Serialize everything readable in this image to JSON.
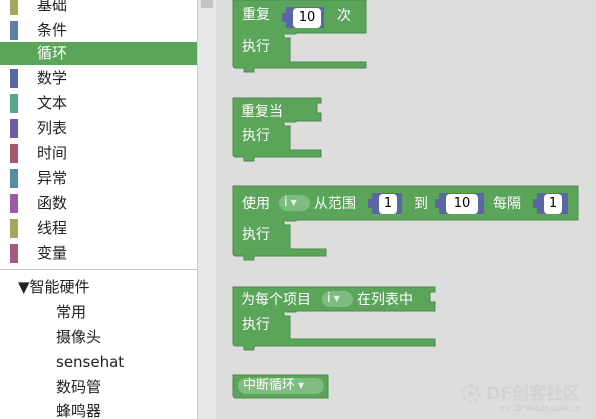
{
  "toolbox": {
    "categories": [
      {
        "label": "基础",
        "color": "#a5a55b"
      },
      {
        "label": "条件",
        "color": "#5b80a5"
      },
      {
        "label": "循环",
        "color": "#5ba55b",
        "selected": true
      },
      {
        "label": "数学",
        "color": "#5b67a5"
      },
      {
        "label": "文本",
        "color": "#5ba58c"
      },
      {
        "label": "列表",
        "color": "#745ba5"
      },
      {
        "label": "时间",
        "color": "#a55b67"
      },
      {
        "label": "异常",
        "color": "#5b8ca5"
      },
      {
        "label": "函数",
        "color": "#995ba5"
      },
      {
        "label": "线程",
        "color": "#a5a55b"
      },
      {
        "label": "变量",
        "color": "#a55b80"
      }
    ],
    "group": {
      "arrow": "▼",
      "label": "智能硬件"
    },
    "subitems": [
      "常用",
      "摄像头",
      "sensehat",
      "数码管",
      "蜂鸣器"
    ]
  },
  "blocks": {
    "repeat": {
      "label": "重复",
      "count": "10",
      "times": "次",
      "do": "执行"
    },
    "while": {
      "label": "重复当",
      "do": "执行"
    },
    "for": {
      "label": "使用",
      "var": "i",
      "from_label": "从范围",
      "from": "1",
      "to_label": "到",
      "to": "10",
      "by_label": "每隔",
      "by": "1",
      "do": "执行"
    },
    "foreach": {
      "label": "为每个项目",
      "var": "i",
      "in_label": "在列表中",
      "do": "执行"
    },
    "break": {
      "label": "中断循环"
    }
  },
  "colors": {
    "loop_block": "#5ba55b",
    "loop_block_dark": "#4a8a4a",
    "number_block": "#5b67a5"
  },
  "watermark": {
    "brand_df": "DF",
    "brand_cn": "创客社区",
    "url": "mc.DFRobot.com.cn"
  }
}
